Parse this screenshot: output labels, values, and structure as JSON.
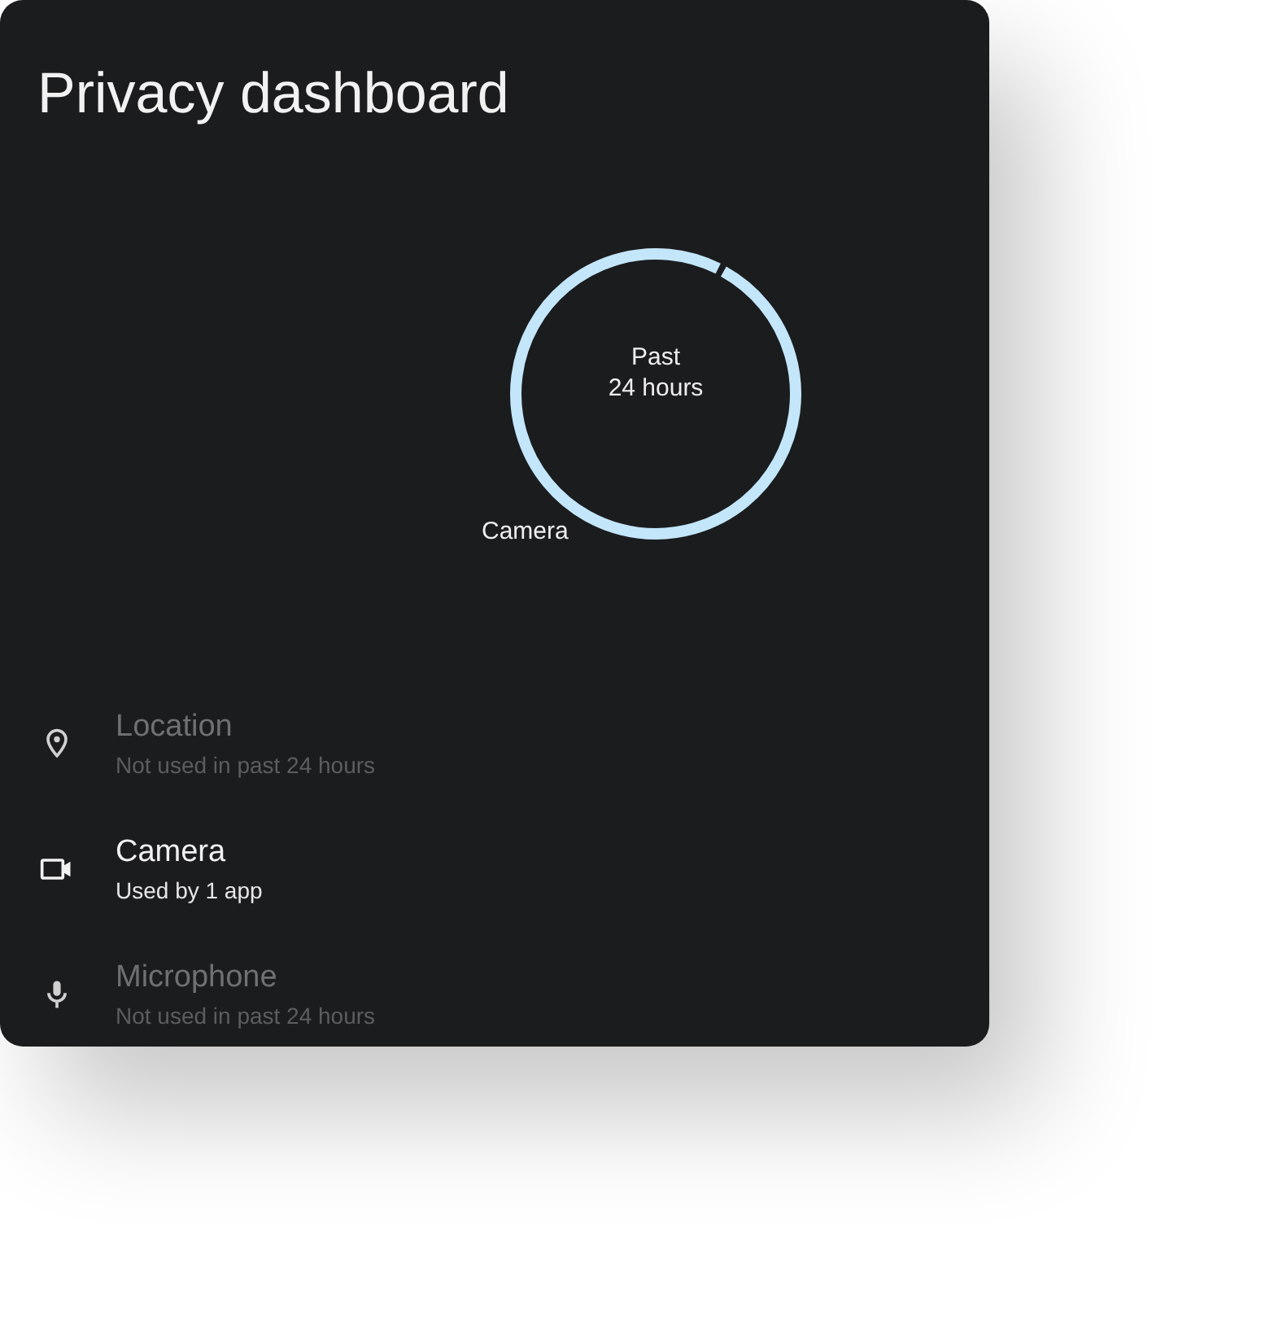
{
  "title": "Privacy dashboard",
  "usage_ring": {
    "center_label": "Past\n24 hours",
    "segment_label": "Camera"
  },
  "permissions": [
    {
      "kind": "location",
      "name": "Location",
      "status": "Not used in past 24 hours",
      "disabled": true
    },
    {
      "kind": "camera",
      "name": "Camera",
      "status": "Used by 1 app",
      "disabled": false
    },
    {
      "kind": "microphone",
      "name": "Microphone",
      "status": "Not used in past 24 hours",
      "disabled": true
    }
  ]
}
